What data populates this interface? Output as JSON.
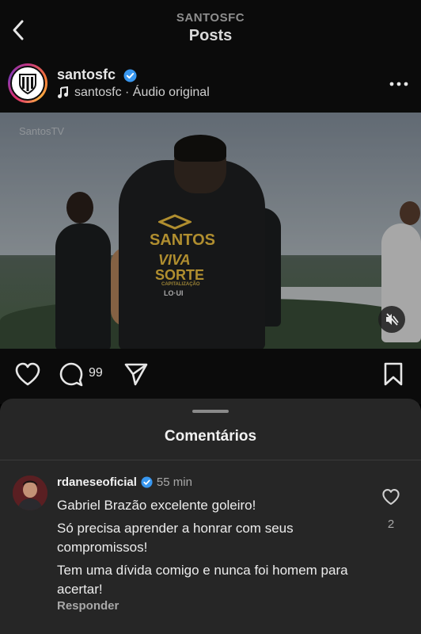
{
  "header": {
    "subtitle": "SANTOSFC",
    "title": "Posts"
  },
  "post": {
    "username": "santosfc",
    "audio": "santosfc · Áudio original",
    "media": {
      "watermark": "SantosTV",
      "jersey_brand": "SANTOS",
      "jersey_sponsor_1": "VIVA",
      "jersey_sponsor_2": "SORTE",
      "jersey_small": "CAPITALIZAÇÃO",
      "jersey_bottom": "LO·UI"
    },
    "comment_count": "99"
  },
  "comments_sheet": {
    "title": "Comentários",
    "comments": [
      {
        "username": "rdaneseoficial",
        "time": "55 min",
        "lines": [
          "Gabriel Brazão excelente goleiro!",
          "Só precisa aprender a honrar com seus compromissos!",
          "Tem uma dívida comigo e nunca foi homem para acertar!"
        ],
        "reply_label": "Responder",
        "like_count": "2"
      }
    ]
  },
  "colors": {
    "background": "#000000",
    "sheet": "#262626",
    "verified": "#3897f0",
    "jersey_text": "#f4c542"
  }
}
